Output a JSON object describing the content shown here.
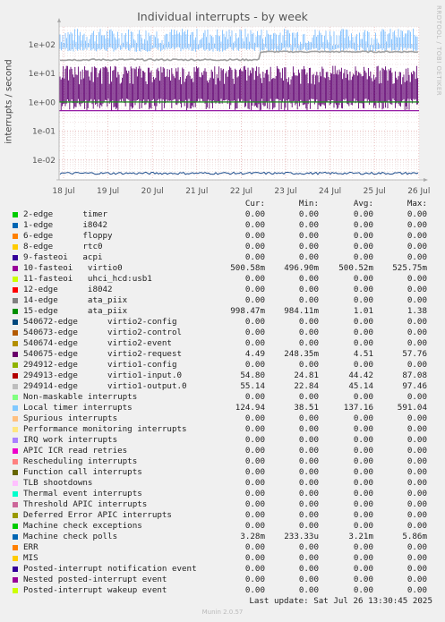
{
  "title": "Individual interrupts - by week",
  "side_label": "RRDTOOL / TOBI OETIKER",
  "footer": "Last update: Sat Jul 26 13:30:45 2025",
  "munin": "Munin 2.0.57",
  "headers": {
    "cur": "Cur:",
    "min": "Min:",
    "avg": "Avg:",
    "max": "Max:"
  },
  "chart_data": {
    "type": "line",
    "title": "Individual interrupts - by week",
    "ylabel": "interrupts / second",
    "yscale": "log",
    "ylim": [
      0.002,
      400
    ],
    "yticks": [
      "1e-02",
      "1e-01",
      "1e+00",
      "1e+01",
      "1e+02"
    ],
    "xticks": [
      "18 Jul",
      "19 Jul",
      "20 Jul",
      "21 Jul",
      "22 Jul",
      "23 Jul",
      "24 Jul",
      "25 Jul",
      "26 Jul"
    ],
    "grid": true,
    "series_visible": [
      {
        "name": "Local timer interrupts",
        "color": "#80c0ff",
        "min": 38.51,
        "max": 591.04
      },
      {
        "name": "294914-edge virtio1-output.0",
        "color": "#a0a0a0",
        "min": 22.84,
        "max": 97.46
      },
      {
        "name": "540675-edge virtio2-request",
        "color": "#600070",
        "min": 0.248,
        "max": 57.76
      },
      {
        "name": "15-edge ata_piix",
        "color": "#228822",
        "min": 0.984,
        "max": 1.38
      },
      {
        "name": "10-fasteoi virtio0",
        "color": "#880099",
        "min": 0.497,
        "max": 0.526
      },
      {
        "name": "Machine check polls",
        "color": "#1a4a8a",
        "min": 0.00023,
        "max": 0.00586
      }
    ]
  },
  "legend": [
    {
      "color": "#00cc00",
      "label": "2-edge      timer",
      "cur": "0.00",
      "min": "0.00",
      "avg": "0.00",
      "max": "0.00"
    },
    {
      "color": "#0066b3",
      "label": "1-edge      i8042",
      "cur": "0.00",
      "min": "0.00",
      "avg": "0.00",
      "max": "0.00"
    },
    {
      "color": "#ff8000",
      "label": "6-edge      floppy",
      "cur": "0.00",
      "min": "0.00",
      "avg": "0.00",
      "max": "0.00"
    },
    {
      "color": "#ffcc00",
      "label": "8-edge      rtc0",
      "cur": "0.00",
      "min": "0.00",
      "avg": "0.00",
      "max": "0.00"
    },
    {
      "color": "#330099",
      "label": "9-fasteoi   acpi",
      "cur": "0.00",
      "min": "0.00",
      "avg": "0.00",
      "max": "0.00"
    },
    {
      "color": "#990099",
      "label": "10-fasteoi   virtio0",
      "cur": "500.58m",
      "min": "496.90m",
      "avg": "500.52m",
      "max": "525.75m"
    },
    {
      "color": "#ccff00",
      "label": "11-fasteoi   uhci_hcd:usb1",
      "cur": "0.00",
      "min": "0.00",
      "avg": "0.00",
      "max": "0.00"
    },
    {
      "color": "#ff0000",
      "label": "12-edge      i8042",
      "cur": "0.00",
      "min": "0.00",
      "avg": "0.00",
      "max": "0.00"
    },
    {
      "color": "#808080",
      "label": "14-edge      ata_piix",
      "cur": "0.00",
      "min": "0.00",
      "avg": "0.00",
      "max": "0.00"
    },
    {
      "color": "#008f00",
      "label": "15-edge      ata_piix",
      "cur": "998.47m",
      "min": "984.11m",
      "avg": "1.01",
      "max": "1.38"
    },
    {
      "color": "#00487d",
      "label": "540672-edge      virtio2-config",
      "cur": "0.00",
      "min": "0.00",
      "avg": "0.00",
      "max": "0.00"
    },
    {
      "color": "#b35a00",
      "label": "540673-edge      virtio2-control",
      "cur": "0.00",
      "min": "0.00",
      "avg": "0.00",
      "max": "0.00"
    },
    {
      "color": "#b38f00",
      "label": "540674-edge      virtio2-event",
      "cur": "0.00",
      "min": "0.00",
      "avg": "0.00",
      "max": "0.00"
    },
    {
      "color": "#6b006b",
      "label": "540675-edge      virtio2-request",
      "cur": "4.49",
      "min": "248.35m",
      "avg": "4.51",
      "max": "57.76"
    },
    {
      "color": "#8fb300",
      "label": "294912-edge      virtio1-config",
      "cur": "0.00",
      "min": "0.00",
      "avg": "0.00",
      "max": "0.00"
    },
    {
      "color": "#b30000",
      "label": "294913-edge      virtio1-input.0",
      "cur": "54.80",
      "min": "24.81",
      "avg": "44.42",
      "max": "87.08"
    },
    {
      "color": "#bebebe",
      "label": "294914-edge      virtio1-output.0",
      "cur": "55.14",
      "min": "22.84",
      "avg": "45.14",
      "max": "97.46"
    },
    {
      "color": "#80ff80",
      "label": "Non-maskable interrupts",
      "cur": "0.00",
      "min": "0.00",
      "avg": "0.00",
      "max": "0.00"
    },
    {
      "color": "#80c9ff",
      "label": "Local timer interrupts",
      "cur": "124.94",
      "min": "38.51",
      "avg": "137.16",
      "max": "591.04"
    },
    {
      "color": "#ffc080",
      "label": "Spurious interrupts",
      "cur": "0.00",
      "min": "0.00",
      "avg": "0.00",
      "max": "0.00"
    },
    {
      "color": "#ffe680",
      "label": "Performance monitoring interrupts",
      "cur": "0.00",
      "min": "0.00",
      "avg": "0.00",
      "max": "0.00"
    },
    {
      "color": "#aa80ff",
      "label": "IRQ work interrupts",
      "cur": "0.00",
      "min": "0.00",
      "avg": "0.00",
      "max": "0.00"
    },
    {
      "color": "#ee00cc",
      "label": "APIC ICR read retries",
      "cur": "0.00",
      "min": "0.00",
      "avg": "0.00",
      "max": "0.00"
    },
    {
      "color": "#ff8080",
      "label": "Rescheduling interrupts",
      "cur": "0.00",
      "min": "0.00",
      "avg": "0.00",
      "max": "0.00"
    },
    {
      "color": "#666600",
      "label": "Function call interrupts",
      "cur": "0.00",
      "min": "0.00",
      "avg": "0.00",
      "max": "0.00"
    },
    {
      "color": "#ffbfff",
      "label": "TLB shootdowns",
      "cur": "0.00",
      "min": "0.00",
      "avg": "0.00",
      "max": "0.00"
    },
    {
      "color": "#00ffcc",
      "label": "Thermal event interrupts",
      "cur": "0.00",
      "min": "0.00",
      "avg": "0.00",
      "max": "0.00"
    },
    {
      "color": "#cc6699",
      "label": "Threshold APIC interrupts",
      "cur": "0.00",
      "min": "0.00",
      "avg": "0.00",
      "max": "0.00"
    },
    {
      "color": "#999900",
      "label": "Deferred Error APIC interrupts",
      "cur": "0.00",
      "min": "0.00",
      "avg": "0.00",
      "max": "0.00"
    },
    {
      "color": "#00cc00",
      "label": "Machine check exceptions",
      "cur": "0.00",
      "min": "0.00",
      "avg": "0.00",
      "max": "0.00"
    },
    {
      "color": "#0066b3",
      "label": "Machine check polls",
      "cur": "3.28m",
      "min": "233.33u",
      "avg": "3.21m",
      "max": "5.86m"
    },
    {
      "color": "#ff8000",
      "label": "ERR",
      "cur": "0.00",
      "min": "0.00",
      "avg": "0.00",
      "max": "0.00"
    },
    {
      "color": "#ffcc00",
      "label": "MIS",
      "cur": "0.00",
      "min": "0.00",
      "avg": "0.00",
      "max": "0.00"
    },
    {
      "color": "#330099",
      "label": "Posted-interrupt notification event",
      "cur": "0.00",
      "min": "0.00",
      "avg": "0.00",
      "max": "0.00"
    },
    {
      "color": "#990099",
      "label": "Nested posted-interrupt event",
      "cur": "0.00",
      "min": "0.00",
      "avg": "0.00",
      "max": "0.00"
    },
    {
      "color": "#ccff00",
      "label": "Posted-interrupt wakeup event",
      "cur": "0.00",
      "min": "0.00",
      "avg": "0.00",
      "max": "0.00"
    }
  ]
}
